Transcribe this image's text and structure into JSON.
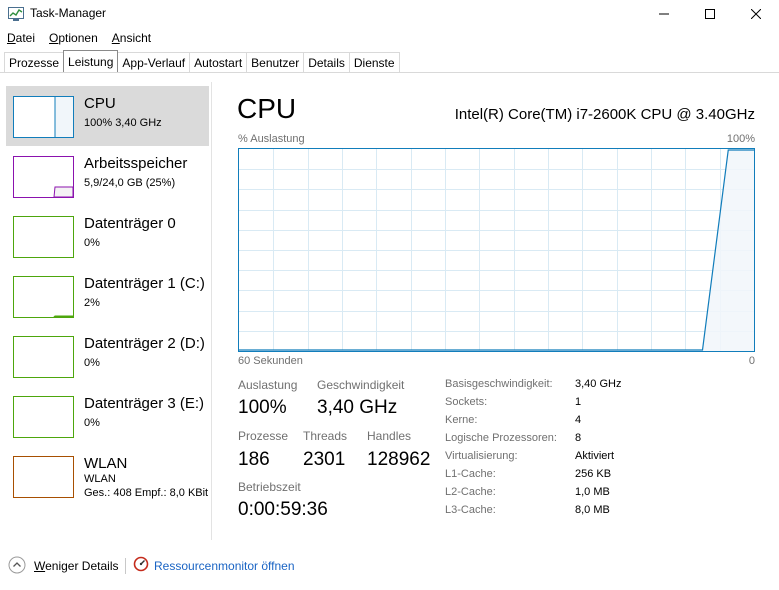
{
  "window": {
    "title": "Task-Manager",
    "app_icon": "task-manager-icon"
  },
  "menu": {
    "items": [
      {
        "label_u": "D",
        "label_rest": "atei"
      },
      {
        "label_u": "O",
        "label_rest": "ptionen"
      },
      {
        "label_u": "A",
        "label_rest": "nsicht"
      }
    ]
  },
  "tabs": [
    {
      "label": "Prozesse",
      "active": false
    },
    {
      "label": "Leistung",
      "active": true
    },
    {
      "label": "App-Verlauf",
      "active": false
    },
    {
      "label": "Autostart",
      "active": false
    },
    {
      "label": "Benutzer",
      "active": false
    },
    {
      "label": "Details",
      "active": false
    },
    {
      "label": "Dienste",
      "active": false
    }
  ],
  "resources": [
    {
      "name": "CPU",
      "sub": "100% 3,40 GHz",
      "sub2": "",
      "color": "#117dbb",
      "fill": "#f1f6fa",
      "selected": true,
      "usage_fraction": 0.3
    },
    {
      "name": "Arbeitsspeicher",
      "sub": "5,9/24,0 GB (25%)",
      "sub2": "",
      "color": "#8b12ae",
      "fill": "#f4f2f4",
      "selected": false,
      "usage_fraction": 0.25
    },
    {
      "name": "Datenträger 0",
      "sub": "0%",
      "sub2": "",
      "color": "#4da60c",
      "fill": "#eff7ea",
      "selected": false,
      "usage_fraction": 0
    },
    {
      "name": "Datenträger 1 (C:)",
      "sub": "2%",
      "sub2": "",
      "color": "#4da60c",
      "fill": "#eff7ea",
      "selected": false,
      "usage_fraction": 0.02
    },
    {
      "name": "Datenträger 2 (D:)",
      "sub": "0%",
      "sub2": "",
      "color": "#4da60c",
      "fill": "#eff7ea",
      "selected": false,
      "usage_fraction": 0
    },
    {
      "name": "Datenträger 3 (E:)",
      "sub": "0%",
      "sub2": "",
      "color": "#4da60c",
      "fill": "#eff7ea",
      "selected": false,
      "usage_fraction": 0
    },
    {
      "name": "WLAN",
      "sub": "WLAN",
      "sub2": "Ges.: 408  Empf.: 8,0 KBit",
      "color": "#a74f01",
      "fill": "#fcf3eb",
      "selected": false,
      "usage_fraction": 0
    }
  ],
  "main": {
    "title": "CPU",
    "model": "Intel(R) Core(TM) i7-2600K CPU @ 3.40GHz",
    "axis_top_left": "% Auslastung",
    "axis_top_right": "100%",
    "axis_bottom_left": "60 Sekunden",
    "axis_bottom_right": "0",
    "graph_color": "#117dbb",
    "graph_fill": "#f1f6fa",
    "grid_color": "#d9eaf4"
  },
  "chart_data": {
    "type": "area",
    "x": [
      60,
      57,
      54,
      51,
      48,
      45,
      42,
      39,
      36,
      33,
      30,
      27,
      24,
      21,
      18,
      15,
      12,
      9,
      6,
      3,
      0
    ],
    "values": [
      0,
      0,
      0,
      0,
      0,
      0,
      0,
      0,
      0,
      0,
      0,
      0,
      0,
      0,
      0,
      0,
      0,
      0,
      0,
      100,
      100
    ],
    "ylim": [
      0,
      100
    ],
    "xlim": [
      60,
      0
    ],
    "xlabel": "60 Sekunden",
    "ylabel": "% Auslastung",
    "grid": true
  },
  "stats": {
    "auslastung_label": "Auslastung",
    "auslastung_value": "100%",
    "geschwindigkeit_label": "Geschwindigkeit",
    "geschwindigkeit_value": "3,40 GHz",
    "prozesse_label": "Prozesse",
    "prozesse_value": "186",
    "threads_label": "Threads",
    "threads_value": "2301",
    "handles_label": "Handles",
    "handles_value": "128962",
    "betriebszeit_label": "Betriebszeit",
    "betriebszeit_value": "0:00:59:36"
  },
  "info": [
    {
      "label": "Basisgeschwindigkeit:",
      "value": "3,40 GHz"
    },
    {
      "label": "Sockets:",
      "value": "1"
    },
    {
      "label": "Kerne:",
      "value": "4"
    },
    {
      "label": "Logische Prozessoren:",
      "value": "8"
    },
    {
      "label": "Virtualisierung:",
      "value": "Aktiviert"
    },
    {
      "label": "L1-Cache:",
      "value": "256 KB"
    },
    {
      "label": "L2-Cache:",
      "value": "1,0 MB"
    },
    {
      "label": "L3-Cache:",
      "value": "8,0 MB"
    }
  ],
  "footer": {
    "fewer_u": "W",
    "fewer_rest": "eniger Details",
    "resmon": "Ressourcenmonitor öffnen"
  }
}
